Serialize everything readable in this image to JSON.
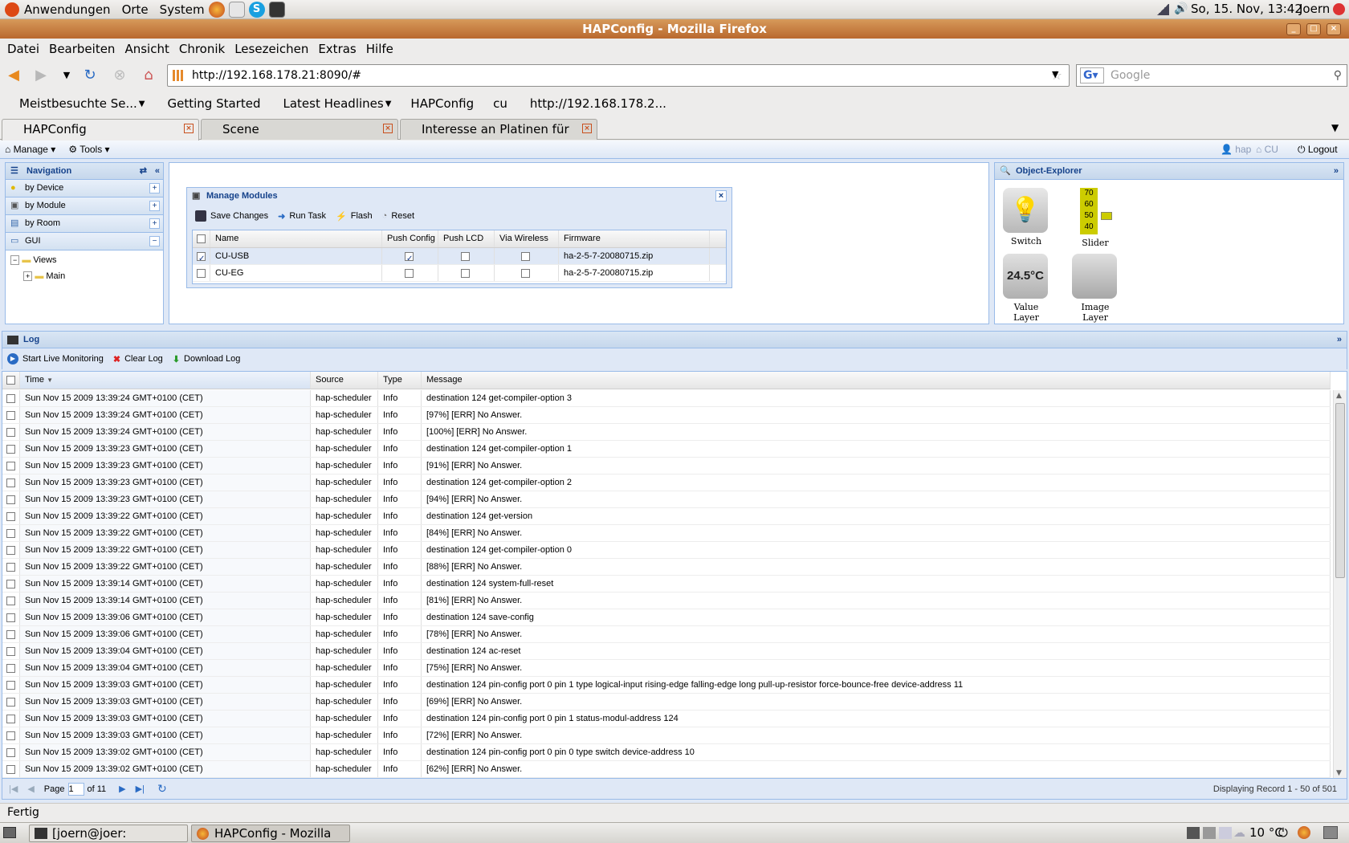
{
  "gnome": {
    "menus": [
      "Anwendungen",
      "Orte",
      "System"
    ],
    "clock": "So, 15. Nov, 13:42",
    "user": "Joern"
  },
  "firefox": {
    "title": "HAPConfig - Mozilla Firefox",
    "menu": [
      "Datei",
      "Bearbeiten",
      "Ansicht",
      "Chronik",
      "Lesezeichen",
      "Extras",
      "Hilfe"
    ],
    "url": "http://192.168.178.21:8090/#",
    "search_placeholder": "Google",
    "bookmarks": [
      "Meistbesuchte Se...",
      "Getting Started",
      "Latest Headlines",
      "HAPConfig",
      "cu",
      "http://192.168.178.2..."
    ],
    "tabs": [
      "HAPConfig",
      "Scene",
      "Interesse an Platinen für HA..."
    ],
    "status": "Fertig"
  },
  "app": {
    "toolbar": {
      "manage": "Manage",
      "tools": "Tools",
      "hap": "hap",
      "cu": "CU",
      "logout": "Logout"
    },
    "navigation": {
      "title": "Navigation",
      "items": [
        "by Device",
        "by Module",
        "by Room",
        "GUI"
      ],
      "tree_root": "Views",
      "tree_child": "Main"
    },
    "modules_window": {
      "title": "Manage Modules",
      "buttons": [
        "Save Changes",
        "Run Task",
        "Flash",
        "Reset"
      ],
      "columns": [
        "Name",
        "Push Config",
        "Push LCD",
        "Via Wireless",
        "Firmware"
      ],
      "rows": [
        {
          "name": "CU-USB",
          "selected": true,
          "push_config": true,
          "push_lcd": false,
          "via_wireless": false,
          "firmware": "ha-2-5-7-20080715.zip"
        },
        {
          "name": "CU-EG",
          "selected": false,
          "push_config": false,
          "push_lcd": false,
          "via_wireless": false,
          "firmware": "ha-2-5-7-20080715.zip"
        }
      ]
    },
    "object_explorer": {
      "title": "Object-Explorer",
      "items": [
        "Switch",
        "Slider",
        "Value Layer",
        "Image Layer"
      ],
      "value_display": "24.5°C",
      "slider_ticks": [
        "70",
        "60",
        "50",
        "40"
      ]
    },
    "log": {
      "title": "Log",
      "buttons": [
        "Start Live Monitoring",
        "Clear Log",
        "Download Log"
      ],
      "columns": [
        "Time",
        "Source",
        "Type",
        "Message"
      ],
      "rows": [
        [
          "Sun Nov 15 2009 13:39:24 GMT+0100 (CET)",
          "hap-scheduler",
          "Info",
          "destination 124 get-compiler-option 3"
        ],
        [
          "Sun Nov 15 2009 13:39:24 GMT+0100 (CET)",
          "hap-scheduler",
          "Info",
          "[97%] [ERR] No Answer."
        ],
        [
          "Sun Nov 15 2009 13:39:24 GMT+0100 (CET)",
          "hap-scheduler",
          "Info",
          "[100%] [ERR] No Answer."
        ],
        [
          "Sun Nov 15 2009 13:39:23 GMT+0100 (CET)",
          "hap-scheduler",
          "Info",
          "destination 124 get-compiler-option 1"
        ],
        [
          "Sun Nov 15 2009 13:39:23 GMT+0100 (CET)",
          "hap-scheduler",
          "Info",
          "[91%] [ERR] No Answer."
        ],
        [
          "Sun Nov 15 2009 13:39:23 GMT+0100 (CET)",
          "hap-scheduler",
          "Info",
          "destination 124 get-compiler-option 2"
        ],
        [
          "Sun Nov 15 2009 13:39:23 GMT+0100 (CET)",
          "hap-scheduler",
          "Info",
          "[94%] [ERR] No Answer."
        ],
        [
          "Sun Nov 15 2009 13:39:22 GMT+0100 (CET)",
          "hap-scheduler",
          "Info",
          "destination 124 get-version"
        ],
        [
          "Sun Nov 15 2009 13:39:22 GMT+0100 (CET)",
          "hap-scheduler",
          "Info",
          "[84%] [ERR] No Answer."
        ],
        [
          "Sun Nov 15 2009 13:39:22 GMT+0100 (CET)",
          "hap-scheduler",
          "Info",
          "destination 124 get-compiler-option 0"
        ],
        [
          "Sun Nov 15 2009 13:39:22 GMT+0100 (CET)",
          "hap-scheduler",
          "Info",
          "[88%] [ERR] No Answer."
        ],
        [
          "Sun Nov 15 2009 13:39:14 GMT+0100 (CET)",
          "hap-scheduler",
          "Info",
          "destination 124 system-full-reset"
        ],
        [
          "Sun Nov 15 2009 13:39:14 GMT+0100 (CET)",
          "hap-scheduler",
          "Info",
          "[81%] [ERR] No Answer."
        ],
        [
          "Sun Nov 15 2009 13:39:06 GMT+0100 (CET)",
          "hap-scheduler",
          "Info",
          "destination 124 save-config"
        ],
        [
          "Sun Nov 15 2009 13:39:06 GMT+0100 (CET)",
          "hap-scheduler",
          "Info",
          "[78%] [ERR] No Answer."
        ],
        [
          "Sun Nov 15 2009 13:39:04 GMT+0100 (CET)",
          "hap-scheduler",
          "Info",
          "destination 124 ac-reset"
        ],
        [
          "Sun Nov 15 2009 13:39:04 GMT+0100 (CET)",
          "hap-scheduler",
          "Info",
          "[75%] [ERR] No Answer."
        ],
        [
          "Sun Nov 15 2009 13:39:03 GMT+0100 (CET)",
          "hap-scheduler",
          "Info",
          "destination 124 pin-config port 0 pin 1 type logical-input rising-edge falling-edge long pull-up-resistor force-bounce-free device-address 11"
        ],
        [
          "Sun Nov 15 2009 13:39:03 GMT+0100 (CET)",
          "hap-scheduler",
          "Info",
          "[69%] [ERR] No Answer."
        ],
        [
          "Sun Nov 15 2009 13:39:03 GMT+0100 (CET)",
          "hap-scheduler",
          "Info",
          "destination 124 pin-config port 0 pin 1 status-modul-address 124"
        ],
        [
          "Sun Nov 15 2009 13:39:03 GMT+0100 (CET)",
          "hap-scheduler",
          "Info",
          "[72%] [ERR] No Answer."
        ],
        [
          "Sun Nov 15 2009 13:39:02 GMT+0100 (CET)",
          "hap-scheduler",
          "Info",
          "destination 124 pin-config port 0 pin 0 type switch device-address 10"
        ],
        [
          "Sun Nov 15 2009 13:39:02 GMT+0100 (CET)",
          "hap-scheduler",
          "Info",
          "[62%] [ERR] No Answer."
        ]
      ],
      "paging": {
        "page_label": "Page",
        "page": "1",
        "of": "of 11",
        "display": "Displaying Record 1 - 50 of 501"
      }
    }
  },
  "taskbar": {
    "tasks": [
      "[joern@joer: /opt/hap/b...",
      "HAPConfig - Mozilla Fir..."
    ],
    "weather": "10 °C"
  }
}
